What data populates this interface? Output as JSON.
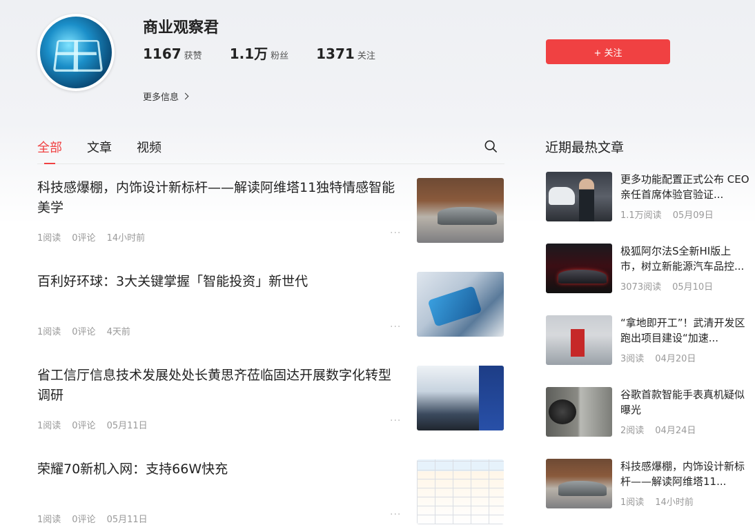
{
  "profile": {
    "name": "商业观察君",
    "stats": [
      {
        "value": "1167",
        "label": "获赞"
      },
      {
        "value": "1.1万",
        "label": "粉丝"
      },
      {
        "value": "1371",
        "label": "关注"
      }
    ],
    "more_info": "更多信息",
    "follow_label": "+ 关注"
  },
  "tabs": [
    {
      "label": "全部",
      "active": true
    },
    {
      "label": "文章",
      "active": false
    },
    {
      "label": "视频",
      "active": false
    }
  ],
  "feed": [
    {
      "title": "科技感爆棚，内饰设计新标杆——解读阿维塔11独特情感智能美学",
      "reads": "1阅读",
      "comments": "0评论",
      "time": "14小时前",
      "more": "···"
    },
    {
      "title": "百利好环球：3大关键掌握「智能投资」新世代",
      "reads": "1阅读",
      "comments": "0评论",
      "time": "4天前",
      "more": "···"
    },
    {
      "title": "省工信厅信息技术发展处处长黄思齐莅临固达开展数字化转型调研",
      "reads": "1阅读",
      "comments": "0评论",
      "time": "05月11日",
      "more": "···"
    },
    {
      "title": "荣耀70新机入网：支持66W快充",
      "reads": "1阅读",
      "comments": "0评论",
      "time": "05月11日",
      "more": "···"
    }
  ],
  "sidebar": {
    "title": "近期最热文章",
    "items": [
      {
        "title": "更多功能配置正式公布 CEO亲任首席体验官验证...",
        "reads": "1.1万阅读",
        "date": "05月09日"
      },
      {
        "title": "极狐阿尔法S全新HI版上市，树立新能源汽车品控...",
        "reads": "3073阅读",
        "date": "05月10日"
      },
      {
        "title": "“拿地即开工”！武清开发区跑出项目建设“加速...",
        "reads": "3阅读",
        "date": "04月20日"
      },
      {
        "title": "谷歌首款智能手表真机疑似曝光",
        "reads": "2阅读",
        "date": "04月24日"
      },
      {
        "title": "科技感爆棚，内饰设计新标杆——解读阿维塔11...",
        "reads": "1阅读",
        "date": "14小时前"
      }
    ]
  }
}
